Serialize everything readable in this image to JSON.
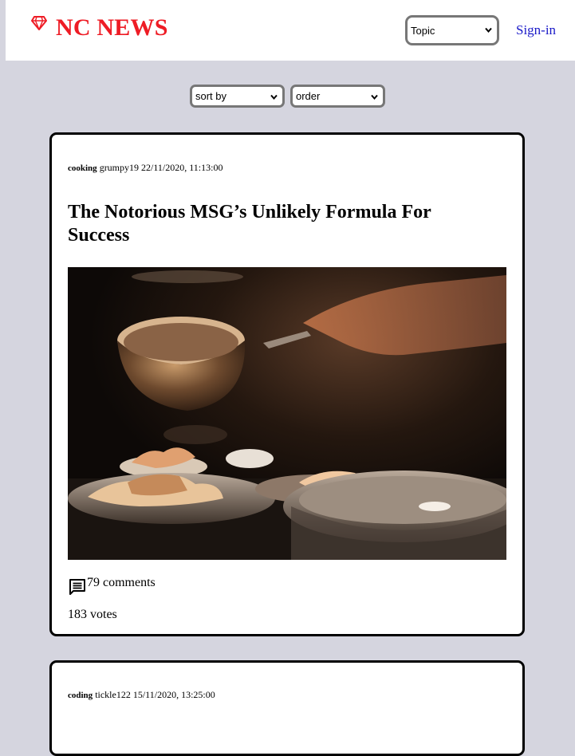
{
  "header": {
    "brand": "NC NEWS",
    "brand_color": "#ee1c25",
    "logo_icon": "gem-icon",
    "topic_select": {
      "selected": "Topic"
    },
    "signin_label": "Sign-in"
  },
  "controls": {
    "sort_by": {
      "selected": "sort by"
    },
    "order": {
      "selected": "order"
    }
  },
  "articles": [
    {
      "topic": "cooking",
      "author": "grumpy19",
      "date": "22/11/2020, 11:13:00",
      "title": "The Notorious MSG’s Unlikely Formula For Success",
      "image_icon": "cooking-photo",
      "comments": "79 comments",
      "comment_icon": "comment-icon",
      "votes": "183 votes"
    },
    {
      "topic": "coding",
      "author": "tickle122",
      "date": "15/11/2020, 13:25:00"
    }
  ],
  "colors": {
    "page_background": "#d5d5df",
    "link": "#1a1ac8"
  }
}
